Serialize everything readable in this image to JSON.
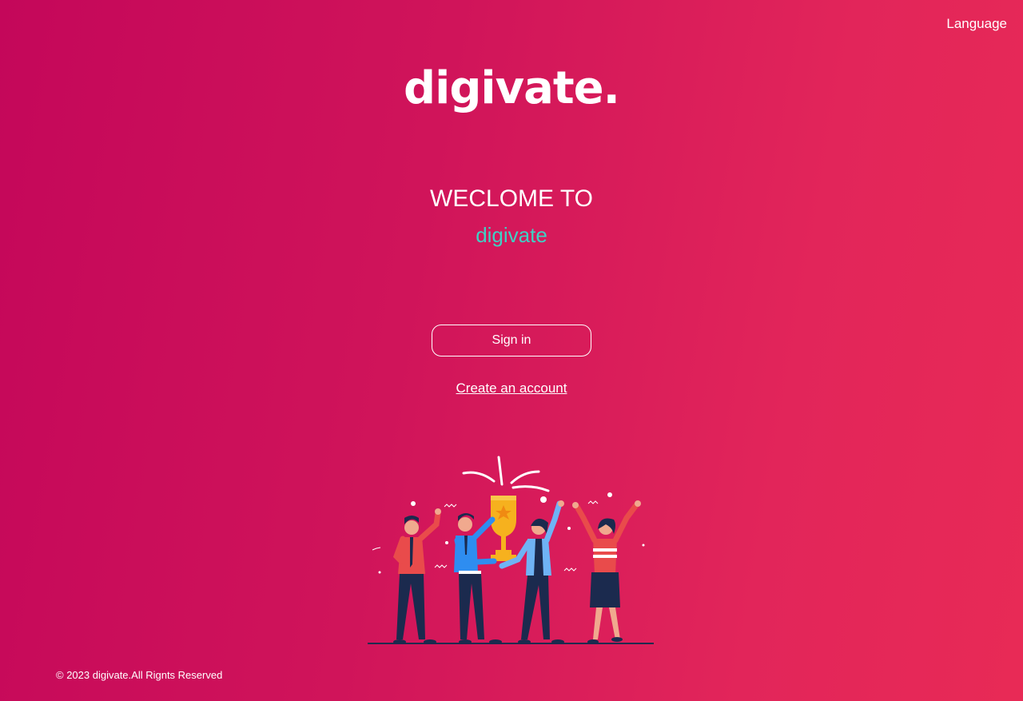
{
  "header": {
    "language_label": "Language"
  },
  "logo": {
    "text": "digivate."
  },
  "hero": {
    "welcome": "WECLOME TO",
    "brand": "digivate"
  },
  "actions": {
    "sign_in": "Sign in",
    "create_account": "Create an account"
  },
  "illustration": {
    "icon": "celebrating-team-trophy-illustration"
  },
  "footer": {
    "copyright": "© 2023 digivate.All Rignts Reserved"
  },
  "colors": {
    "bg_start": "#c4075a",
    "bg_end": "#e82a56",
    "accent": "#3fd0c4"
  }
}
